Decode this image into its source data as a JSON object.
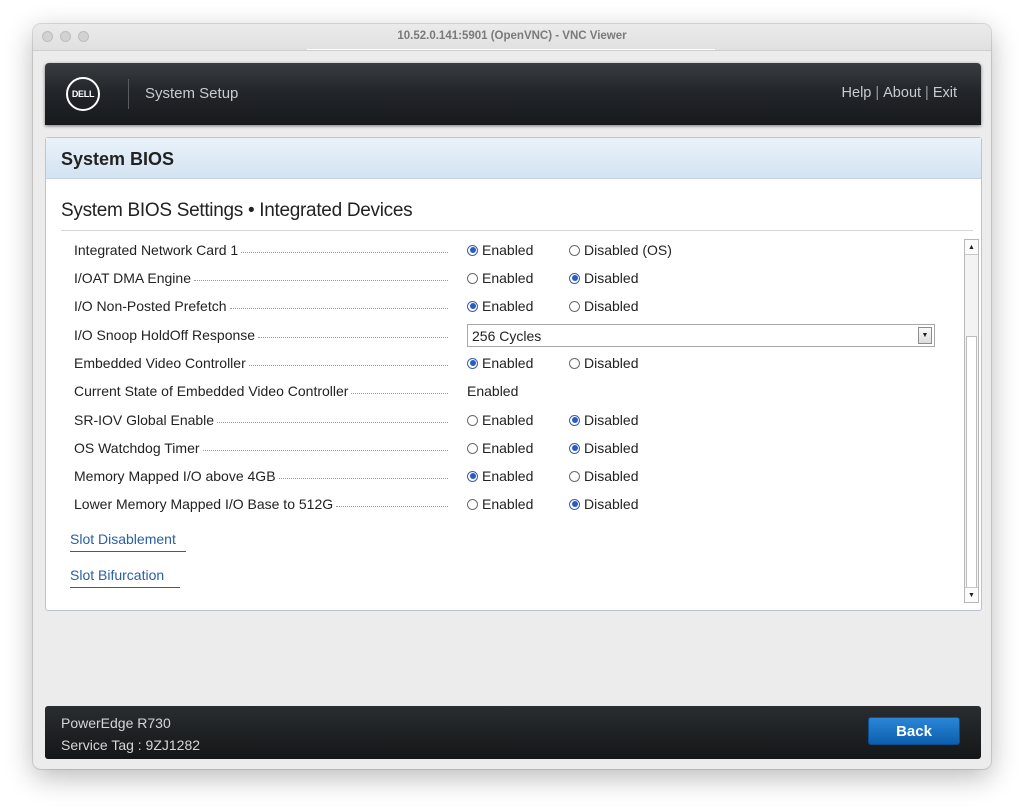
{
  "window": {
    "title": "10.52.0.141:5901 (OpenVNC) - VNC Viewer"
  },
  "header": {
    "logo_text": "DELL",
    "title": "System Setup",
    "help": "Help",
    "about": "About",
    "exit": "Exit",
    "separator": "|"
  },
  "panel": {
    "title": "System BIOS",
    "section_title": "System BIOS Settings • Integrated Devices"
  },
  "settings": [
    {
      "label": "Integrated Network Card 1",
      "options": [
        "Enabled",
        "Disabled (OS)"
      ],
      "selected": "Enabled"
    },
    {
      "label": "I/OAT DMA Engine",
      "options": [
        "Enabled",
        "Disabled"
      ],
      "selected": "Disabled"
    },
    {
      "label": "I/O Non-Posted Prefetch",
      "options": [
        "Enabled",
        "Disabled"
      ],
      "selected": "Enabled"
    },
    {
      "label": "I/O Snoop HoldOff Response",
      "value": "256 Cycles"
    },
    {
      "label": "Embedded Video Controller",
      "options": [
        "Enabled",
        "Disabled"
      ],
      "selected": "Enabled"
    },
    {
      "label": "Current State of Embedded Video Controller",
      "value": "Enabled"
    },
    {
      "label": "SR-IOV Global Enable",
      "options": [
        "Enabled",
        "Disabled"
      ],
      "selected": "Disabled"
    },
    {
      "label": "OS Watchdog Timer",
      "options": [
        "Enabled",
        "Disabled"
      ],
      "selected": "Disabled"
    },
    {
      "label": "Memory Mapped I/O above 4GB",
      "options": [
        "Enabled",
        "Disabled"
      ],
      "selected": "Enabled"
    },
    {
      "label": "Lower Memory Mapped I/O Base to 512G",
      "options": [
        "Enabled",
        "Disabled"
      ],
      "selected": "Disabled"
    }
  ],
  "links": {
    "slot_disablement": "Slot Disablement",
    "slot_bifurcation": "Slot Bifurcation"
  },
  "footer": {
    "model": "PowerEdge R730",
    "service_tag": "Service Tag : 9ZJ1282",
    "back_label": "Back"
  },
  "icons": {
    "scroll_up": "▲",
    "scroll_down": "▼",
    "dropdown": "▼"
  },
  "colors": {
    "accent_blue": "#1a6fc2",
    "radio_selected": "#2b5bc4",
    "link": "#2a5fa3"
  }
}
